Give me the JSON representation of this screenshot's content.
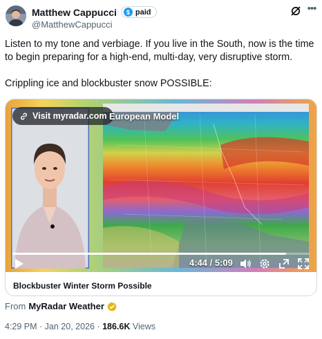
{
  "author": {
    "name": "Matthew Cappucci",
    "badge_label": "paid",
    "badge_symbol": "$",
    "handle": "@MatthewCappucci"
  },
  "tweet_text": {
    "paragraph1": "Listen to my tone and verbiage. If you live in the South, now is the time to begin preparing for a high-end, multi-day, very disruptive storm.",
    "paragraph2": "Crippling ice and blockbuster snow POSSIBLE:"
  },
  "video": {
    "visit_label": "Visit myradar.com",
    "model_label": "European Model",
    "time_label": "4:44 / 5:09",
    "progress_fraction": 0.92,
    "card_title": "Blockbuster Winter Storm Possible"
  },
  "from_line": {
    "prefix": "From",
    "source": "MyRadar Weather"
  },
  "meta": {
    "timestamp": "4:29 PM · Jan 20, 2026 · ",
    "views_count": "186.6K",
    "views_label": " Views"
  },
  "colors": {
    "accent": "#1d9bf0",
    "verified_gold": "#e2b719",
    "text_primary": "#0f1419",
    "text_secondary": "#536471"
  },
  "icons": [
    "grok-icon",
    "more-icon",
    "link-icon",
    "play-icon",
    "volume-icon",
    "settings-icon",
    "popout-icon",
    "fullscreen-icon",
    "gold-verified-icon"
  ]
}
